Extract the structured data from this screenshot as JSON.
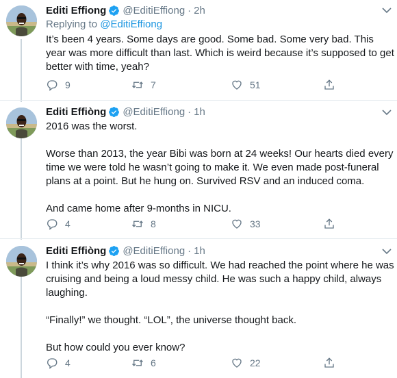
{
  "tweets": [
    {
      "name": "Editi Effiong",
      "handle": "@EditiEffiong",
      "time": "2h",
      "replying_prefix": "Replying to",
      "replying_to": "@EditiEffiong",
      "paragraphs": [
        "It’s been 4 years. Some days are good. Some bad. Some very bad. This year was more difficult than last. Which is weird because it’s supposed to get better with time, yeah?"
      ],
      "replies": "9",
      "retweets": "7",
      "likes": "51"
    },
    {
      "name": "Editi Effiòng",
      "handle": "@EditiEffiong",
      "time": "1h",
      "paragraphs": [
        "2016 was the worst.",
        "Worse than 2013, the year Bibi was born at 24 weeks! Our hearts died every time we were told he wasn’t going to make it. We even made post-funeral plans at a point. But he hung on. Survived RSV and an induced coma.",
        "And came home after 9-months in NICU."
      ],
      "replies": "4",
      "retweets": "8",
      "likes": "33"
    },
    {
      "name": "Editi Effiòng",
      "handle": "@EditiEffiong",
      "time": "1h",
      "paragraphs": [
        "I think it’s why 2016 was so difficult. We had reached the point where he was cruising and being a loud messy child. He was such a happy child, always laughing.",
        "“Finally!” we thought. “LOL”, the universe thought back.",
        "But how could you ever know?"
      ],
      "replies": "4",
      "retweets": "6",
      "likes": "22"
    }
  ],
  "separator": "·",
  "icons": {
    "reply": "reply-icon",
    "retweet": "retweet-icon",
    "like": "heart-icon",
    "share": "share-icon",
    "verified": "verified-badge-icon",
    "more": "chevron-down-icon"
  },
  "colors": {
    "text": "#14171a",
    "secondary": "#657786",
    "link": "#1b95e0",
    "verified": "#1da1f2",
    "divider": "#e6ecf0",
    "thread_line": "#ccd6dd"
  }
}
